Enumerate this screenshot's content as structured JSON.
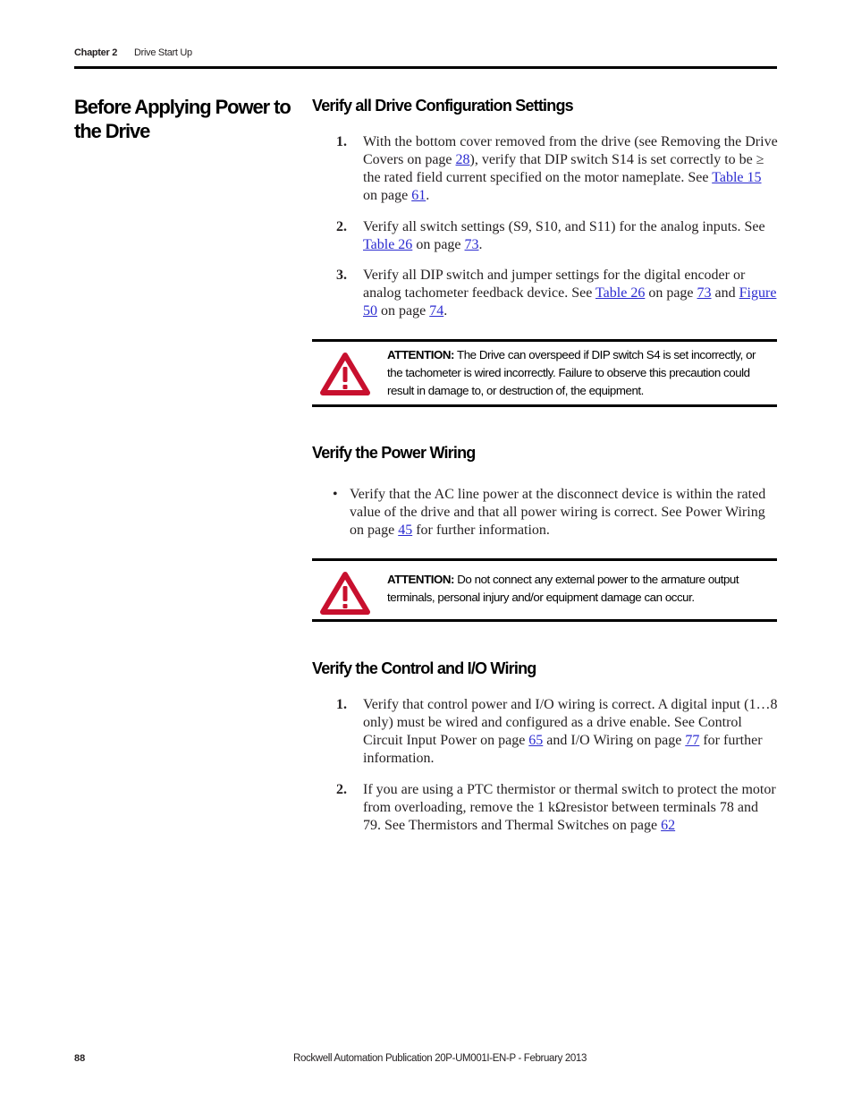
{
  "header": {
    "chapter": "Chapter 2",
    "section": "Drive Start Up"
  },
  "page_title": "Before Applying Power to the Drive",
  "sections": [
    {
      "heading": "Verify all Drive Configuration Settings",
      "items": [
        {
          "marker": "1.",
          "parts": [
            {
              "t": "With the bottom cover removed from the drive (see Removing the Drive Covers on page "
            },
            {
              "link": "28"
            },
            {
              "t": "), verify that DIP switch S14 is set correctly to be ≥ the rated field current specified on the motor nameplate. See "
            },
            {
              "link": "Table 15"
            },
            {
              "t": " on page "
            },
            {
              "link": "61"
            },
            {
              "t": "."
            }
          ]
        },
        {
          "marker": "2.",
          "parts": [
            {
              "t": "Verify all switch settings (S9, S10, and S11) for the analog inputs. See "
            },
            {
              "link": "Table 26"
            },
            {
              "t": " on page "
            },
            {
              "link": "73"
            },
            {
              "t": "."
            }
          ]
        },
        {
          "marker": "3.",
          "parts": [
            {
              "t": "Verify all DIP switch and jumper settings for the digital encoder or analog tachometer feedback device. See "
            },
            {
              "link": "Table 26"
            },
            {
              "t": " on page "
            },
            {
              "link": "73"
            },
            {
              "t": " and "
            },
            {
              "link": "Figure 50"
            },
            {
              "t": " on page "
            },
            {
              "link": "74"
            },
            {
              "t": "."
            }
          ]
        }
      ],
      "attention": {
        "label": "ATTENTION:",
        "text": " The Drive can overspeed if DIP switch S4 is set incorrectly, or the tachometer is wired incorrectly. Failure to observe this precaution could result in damage to, or destruction of, the equipment.",
        "icon": "warning-triangle-icon"
      }
    },
    {
      "heading": "Verify the Power Wiring",
      "items": [
        {
          "marker": "•",
          "parts": [
            {
              "t": "Verify that the AC line power at the disconnect device is within the rated value of the drive and that all power wiring is correct. See Power Wiring on page "
            },
            {
              "link": "45"
            },
            {
              "t": " for further information."
            }
          ]
        }
      ],
      "attention": {
        "label": "ATTENTION:",
        "text": " Do not connect any external power to the armature output terminals, personal injury and/or equipment damage can occur.",
        "icon": "warning-triangle-icon"
      }
    },
    {
      "heading": "Verify the Control and I/O Wiring",
      "items": [
        {
          "marker": "1.",
          "parts": [
            {
              "t": "Verify that control power and I/O wiring is correct. A digital input (1…8 only) must be wired and configured as a drive enable. See Control Circuit Input Power on page "
            },
            {
              "link": "65"
            },
            {
              "t": " and I/O Wiring on page "
            },
            {
              "link": "77"
            },
            {
              "t": " for further information."
            }
          ]
        },
        {
          "marker": "2.",
          "parts": [
            {
              "t": "If you are using a PTC thermistor or thermal switch to protect the motor from overloading, remove the 1 kΩresistor between terminals 78 and 79. See Thermistors and Thermal Switches on page "
            },
            {
              "link": "62"
            }
          ]
        }
      ]
    }
  ],
  "footer": {
    "page_number": "88",
    "publication": "Rockwell Automation Publication 20P-UM001I-EN-P - February 2013"
  },
  "colors": {
    "link": "#2a2ad0",
    "warning": "#c8102e",
    "rule": "#000000"
  }
}
